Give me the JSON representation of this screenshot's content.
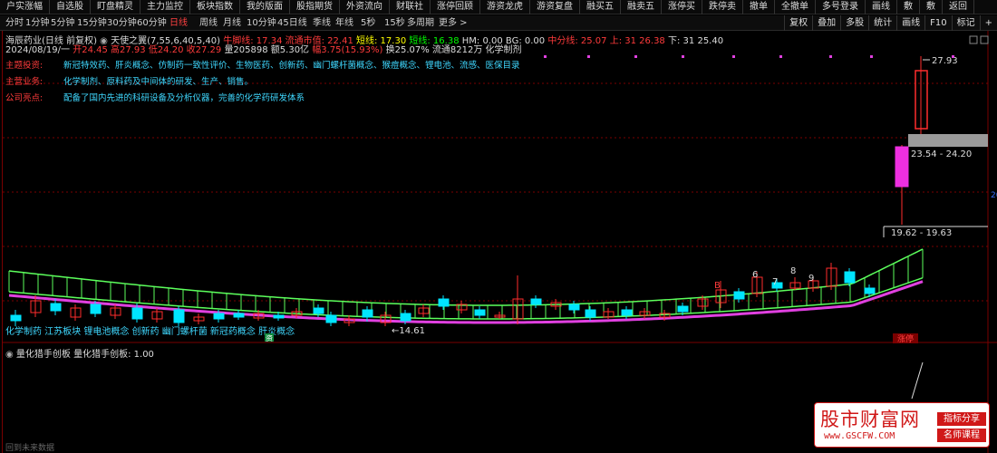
{
  "topbar": [
    "户实涨幅",
    "自选股",
    "盯盘精灵",
    "主力监控",
    "板块指数",
    "我的版面",
    "股指期货",
    "外资流向",
    "财联社",
    "涨停回顾",
    "游资龙虎",
    "游资复盘",
    "融买五",
    "融卖五",
    "涨停买",
    "跌停卖",
    "撤单",
    "全撤单",
    "多号登录",
    "画线",
    "敷",
    "敷",
    "返回"
  ],
  "periods": [
    "分时",
    "1分钟",
    "5分钟",
    "15分钟",
    "30分钟",
    "60分钟",
    "日线",
    "周线",
    "月线",
    "10分钟",
    "45日线",
    "季线",
    "年线",
    "5秒",
    "15秒",
    "多周期",
    "更多 >"
  ],
  "active_period": "日线",
  "right_tools": [
    "复权",
    "叠加",
    "多股",
    "统计",
    "画线",
    "F10",
    "标记",
    "+"
  ],
  "stock": {
    "name": "海辰药业(日线 前复权)",
    "indicator": "天使之翼(7,55,6,40,5,40)",
    "lines": [
      {
        "label": "牛脚线",
        "value": "17.34",
        "color": "#ff3b3b"
      },
      {
        "label": "流通市值",
        "value": "22.41",
        "color": "#ff3b3b"
      },
      {
        "label": "短线",
        "value": "17.30",
        "color": "#ffff00"
      },
      {
        "label": "短线",
        "value": "16.38",
        "color": "#00ff00"
      },
      {
        "label": "HM",
        "value": "0.00",
        "color": "#ddd"
      },
      {
        "label": "BG",
        "value": "0.00",
        "color": "#ddd"
      },
      {
        "label": "中分线",
        "value": "25.07",
        "color": "#ff3b3b"
      },
      {
        "label": "上",
        "value": "31 26.38",
        "color": "#ff3b3b"
      },
      {
        "label": "下",
        "value": "31 25.40",
        "color": "#ddd"
      }
    ],
    "ohlc": {
      "date": "2024/08/19/一",
      "open": "开24.45",
      "high": "高27.93",
      "low": "低24.20",
      "close": "收27.29",
      "vol": "量205898",
      "amount": "额5.30亿",
      "change": "幅3.75(15.93%)",
      "turnover": "换25.07%",
      "float": "流通8212万",
      "industry": "化学制剂"
    }
  },
  "info": [
    {
      "key": "主题投资:",
      "value": "新冠特效药、肝炎概念、仿制药一致性评价、生物医药、创新药、幽门螺杆菌概念、猴痘概念、锂电池、流感、医保目录"
    },
    {
      "key": "主营业务:",
      "value": "化学制剂、原料药及中间体的研发、生产、销售。"
    },
    {
      "key": "公司亮点:",
      "value": "配备了国内先进的科研设备及分析仪器，完善的化学药研发体系"
    }
  ],
  "price_labels": {
    "high": "27.93",
    "gray_band": "23.54 - 24.20",
    "low_band": "19.62 - 19.63",
    "min": "14.61",
    "right_edge": "20"
  },
  "candle_numbers": [
    "6",
    "7",
    "8",
    "9"
  ],
  "red_marker": "B",
  "tags_row": "化学制药 江苏板块 锂电池概念 创新药 幽门螺杆菌 新冠药概念 肝炎概念",
  "small_tag": "资",
  "zhangting_label": "涨停",
  "indicator2": "量化猎手创板 量化猎手创板: 1.00",
  "bottom_text": "回到未来数据",
  "watermark": {
    "title": "股市财富网",
    "url": "www.GSCFW.COM",
    "tag1": "指标分享",
    "tag2": "名师课程"
  },
  "colors": {
    "up": "#ff2d2d",
    "down": "#00e5ff",
    "green_band": "#5cff5c",
    "magenta": "#e040e0"
  }
}
